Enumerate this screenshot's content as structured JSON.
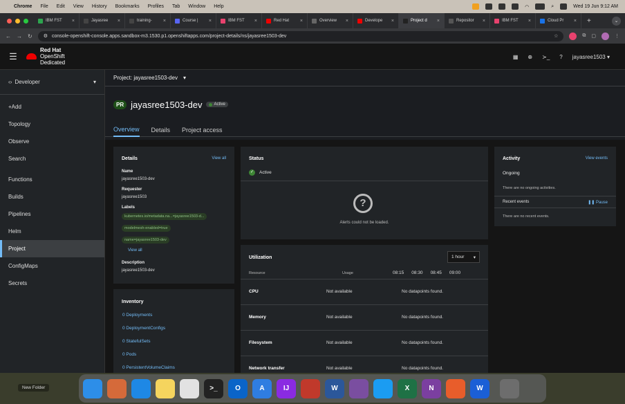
{
  "menubar": {
    "apple": "",
    "items": [
      "Chrome",
      "File",
      "Edit",
      "View",
      "History",
      "Bookmarks",
      "Profiles",
      "Tab",
      "Window",
      "Help"
    ],
    "datetime": "Wed 19 Jun  9:12 AM"
  },
  "tabs": [
    {
      "label": "IBM FST",
      "color": "#2da44e"
    },
    {
      "label": "Jayasree",
      "color": "#444"
    },
    {
      "label": "training-",
      "color": "#444"
    },
    {
      "label": "Course |",
      "color": "#5865f2"
    },
    {
      "label": "IBM FST",
      "color": "#e8426e"
    },
    {
      "label": "Red Hat",
      "color": "#e00"
    },
    {
      "label": "Overview",
      "color": "#666"
    },
    {
      "label": "Develope",
      "color": "#e00"
    },
    {
      "label": "Project d",
      "color": "#222"
    },
    {
      "label": "Repositor",
      "color": "#555"
    },
    {
      "label": "IBM FST",
      "color": "#e8426e"
    },
    {
      "label": "Cloud Pr",
      "color": "#1a73e8"
    }
  ],
  "url": "console-openshift-console.apps.sandbox-m3.1530.p1.openshiftapps.com/project-details/ns/jayasree1503-dev",
  "masthead": {
    "brand_line1": "Red Hat",
    "brand_line2": "OpenShift",
    "brand_line3": "Dedicated",
    "user": "jayasree1503 ▾"
  },
  "sidebar": {
    "perspective": "Developer",
    "items": [
      "+Add",
      "Topology",
      "Observe",
      "Search",
      "Functions",
      "Builds",
      "Pipelines",
      "Helm",
      "Project",
      "ConfigMaps",
      "Secrets"
    ]
  },
  "project": {
    "selector": "Project: jayasree1503-dev",
    "badge": "PR",
    "name": "jayasree1503-dev",
    "status": "Active"
  },
  "page_tabs": [
    "Overview",
    "Details",
    "Project access"
  ],
  "details": {
    "title": "Details",
    "view_all": "View all",
    "name_label": "Name",
    "name": "jayasree1503-dev",
    "requester_label": "Requester",
    "requester": "jayasree1503",
    "labels_label": "Labels",
    "labels": [
      "kubernetes.io/metadata.na...=jayasree1503-d...",
      "modelmesh-enabled=true",
      "name=jayasree1503-dev"
    ],
    "labels_view_all": "View all",
    "description_label": "Description",
    "description": "jayasree1503-dev"
  },
  "status": {
    "title": "Status",
    "state": "Active",
    "alert_msg": "Alerts could not be loaded."
  },
  "activity": {
    "title": "Activity",
    "view_events": "View events",
    "ongoing": "Ongoing",
    "ongoing_msg": "There are no ongoing activities.",
    "recent": "Recent events",
    "pause": "Pause",
    "recent_msg": "There are no recent events."
  },
  "inventory": {
    "title": "Inventory",
    "items": [
      "0 Deployments",
      "0 DeploymentConfigs",
      "0 StatefulSets",
      "0 Pods",
      "0 PersistentVolumeClaims"
    ]
  },
  "utilization": {
    "title": "Utilization",
    "range": "1 hour",
    "col_resource": "Resource",
    "col_usage": "Usage",
    "times": [
      "08:15",
      "08:30",
      "08:45",
      "09:00"
    ],
    "rows": [
      {
        "resource": "CPU",
        "usage": "Not available",
        "chart": "No datapoints found."
      },
      {
        "resource": "Memory",
        "usage": "Not available",
        "chart": "No datapoints found."
      },
      {
        "resource": "Filesystem",
        "usage": "Not available",
        "chart": "No datapoints found."
      },
      {
        "resource": "Network transfer",
        "usage": "Not available",
        "chart": "No datapoints found."
      }
    ]
  },
  "desktop": {
    "new_folder": "New Folder"
  },
  "dock_apps": [
    {
      "name": "finder",
      "color": "#2d8ee8",
      "glyph": ""
    },
    {
      "name": "launchpad",
      "color": "#d56a3a",
      "glyph": ""
    },
    {
      "name": "safari",
      "color": "#1e88e5",
      "glyph": ""
    },
    {
      "name": "notes",
      "color": "#f5d45e",
      "glyph": ""
    },
    {
      "name": "chrome",
      "color": "#e2e2e2",
      "glyph": ""
    },
    {
      "name": "terminal",
      "color": "#222",
      "glyph": ">_"
    },
    {
      "name": "outlook",
      "color": "#0a64c8",
      "glyph": "O"
    },
    {
      "name": "xcode-instruments",
      "color": "#2f7de1",
      "glyph": "A"
    },
    {
      "name": "intellij",
      "color": "#8a2be2",
      "glyph": "IJ"
    },
    {
      "name": "preview",
      "color": "#c0392b",
      "glyph": ""
    },
    {
      "name": "word",
      "color": "#2b579a",
      "glyph": "W"
    },
    {
      "name": "eclipse",
      "color": "#7a4ea0",
      "glyph": ""
    },
    {
      "name": "xcode",
      "color": "#1b9cf2",
      "glyph": ""
    },
    {
      "name": "excel",
      "color": "#1e7145",
      "glyph": "X"
    },
    {
      "name": "onenote",
      "color": "#7b3fa0",
      "glyph": "N"
    },
    {
      "name": "slideshow",
      "color": "#e85d2b",
      "glyph": ""
    },
    {
      "name": "webex",
      "color": "#1b5fd6",
      "glyph": "W"
    },
    {
      "name": "trash",
      "color": "#6d6d6d",
      "glyph": ""
    }
  ]
}
